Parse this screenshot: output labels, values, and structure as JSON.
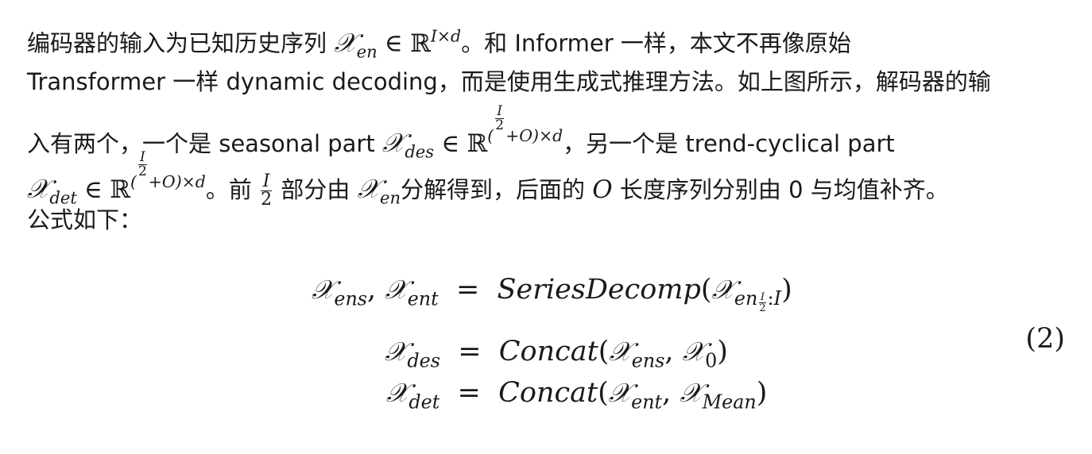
{
  "paragraph": {
    "l1_a": "编码器的输入为已知历史序列",
    "l1_b": "。和 Informer 一样，本文不再像原始",
    "l2": "Transformer 一样 dynamic decoding，而是使用生成式推理方法。如上图所示，解码器的输",
    "l3_a": "入有两个，一个是 seasonal part",
    "l3_b": "，另一个是 trend-cyclical part",
    "l4_a": "。前",
    "l4_b": "部分由",
    "l4_c": "分解得到，后面的",
    "l4_d": "长度序列分别由 0 与均值补齐。",
    "l5": "公式如下："
  },
  "math": {
    "X": "𝒳",
    "en": "en",
    "des": "des",
    "det": "det",
    "ens": "ens",
    "ent": "ent",
    "in": "∈",
    "R": "ℝ",
    "I": "I",
    "d": "d",
    "O": "O",
    "two": "2",
    "times": "×",
    "plus": "+",
    "zero": "0",
    "mean": "Mean",
    "series_decomp": "SeriesDecomp",
    "concat": "Concat",
    "eq": "=",
    "comma": ",",
    "eq_number": "(2)"
  }
}
